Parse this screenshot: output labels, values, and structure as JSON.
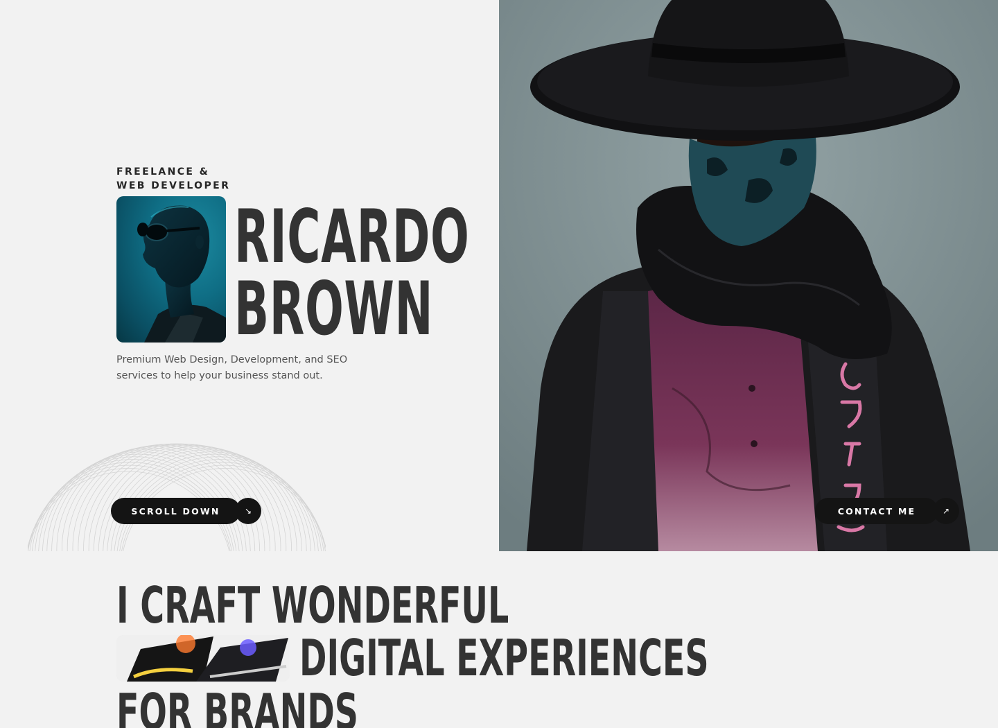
{
  "hero": {
    "eyebrow_line1": "FREELANCE &",
    "eyebrow_line2": "WEB DEVELOPER",
    "name_line1": "RICARDO",
    "name_line2": "BROWN",
    "tagline": "Premium Web Design, Development, and SEO services to help your business stand out.",
    "scroll_label": "SCROLL DOWN",
    "scroll_icon": "arrow-down-right-icon",
    "contact_label": "CONTACT ME",
    "contact_icon": "arrow-up-right-icon"
  },
  "craft": {
    "line1": "I CRAFT WONDERFUL",
    "line2": "DIGITAL EXPERIENCES",
    "line3": "FOR BRANDS"
  },
  "colors": {
    "background": "#f2f2f2",
    "text": "#333333",
    "button": "#141414",
    "portrait_accent": "#0f6e85",
    "photo_backdrop": "#7f8f92",
    "shirt": "#6e2f52"
  }
}
